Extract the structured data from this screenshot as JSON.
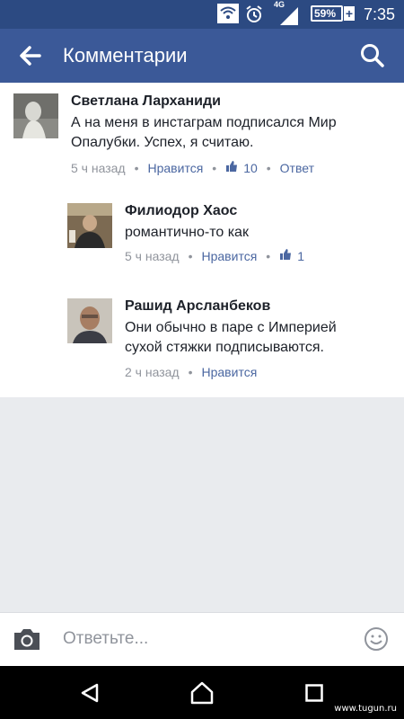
{
  "status_bar": {
    "network": "4G",
    "battery": "59%",
    "time": "7:35"
  },
  "app_bar": {
    "title": "Комментарии"
  },
  "comments": [
    {
      "author": "Светлана Ларханиди",
      "text": "А на меня в инстаграм подписался Мир\nОпалубки. Успех, я считаю.",
      "time": "5 ч назад",
      "like_label": "Нравится",
      "likes": "10",
      "reply_label": "Ответ"
    },
    {
      "author": "Филиодор Хаос",
      "text": "романтично-то как",
      "time": "5 ч назад",
      "like_label": "Нравится",
      "likes": "1"
    },
    {
      "author": "Рашид Арсланбеков",
      "text": "Они обычно в паре с Империей\nсухой стяжки подписываются.",
      "time": "2 ч назад",
      "like_label": "Нравится"
    }
  ],
  "composer": {
    "placeholder": "Ответьте..."
  },
  "watermark": "www.tugun.ru",
  "colors": {
    "app_bar": "#3b5998",
    "status_bar": "#2c4a82",
    "link": "#4b67a1"
  }
}
